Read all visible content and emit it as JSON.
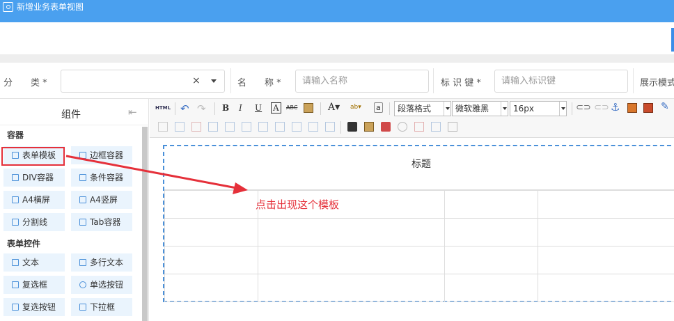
{
  "window": {
    "title": "新增业务表单视图"
  },
  "form": {
    "category_label": "分　　类 *",
    "name_label": "名　　称 *",
    "name_placeholder": "请输入名称",
    "key_label": "标 识 键 *",
    "key_placeholder": "请输入标识键",
    "display_label": "展示模式",
    "clear_glyph": "×"
  },
  "sidebar": {
    "header": "组件",
    "groups": [
      {
        "label": "容器",
        "items": [
          "表单模板",
          "边框容器",
          "DIV容器",
          "条件容器",
          "A4横屏",
          "A4竖屏",
          "分割线",
          "Tab容器"
        ]
      },
      {
        "label": "表单控件",
        "items": [
          "文本",
          "多行文本",
          "复选框",
          "单选按钮",
          "复选按钮",
          "下拉框"
        ]
      }
    ]
  },
  "toolbar": {
    "html_label": "HTML",
    "paragraph_format": "段落格式",
    "font_family": "微软雅黑",
    "font_size": "16px"
  },
  "template": {
    "title": "标题"
  },
  "annotation": {
    "text": "点击出现这个模板"
  },
  "colors": {
    "header_blue": "#4aa0ef",
    "annotation_red": "#e5303a",
    "component_bg": "#eaf4fd"
  }
}
